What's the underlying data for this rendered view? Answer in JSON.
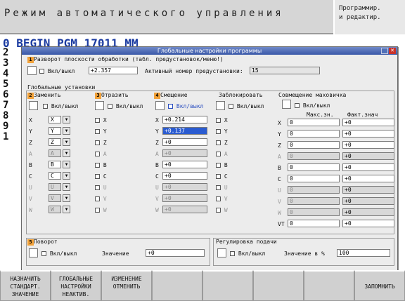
{
  "header": {
    "title": "Режим автоматического управления",
    "mode": "Программир.\nи редактир."
  },
  "program": {
    "first_line": "0 BEGIN PGM 17011 MM",
    "line_numbers": [
      "1",
      "2",
      "3",
      "4",
      "5",
      "6",
      "7",
      "8",
      "9",
      "1"
    ]
  },
  "dialog": {
    "title": "Глобальные настройки программы",
    "plane_tilt": {
      "num": "1",
      "label": "Разворот плоскости обработки (табл. предустановок/меню!)",
      "toggle": "Вкл/выкл",
      "value": "+2.357",
      "preset_label": "Активный номер предустановки:",
      "preset_value": "15"
    },
    "global_section": "Глобальные установки",
    "swap": {
      "num": "2",
      "label": "Заменить",
      "toggle": "Вкл/выкл",
      "axes": [
        "X",
        "Y",
        "Z",
        "A",
        "B",
        "C",
        "U",
        "V",
        "W"
      ],
      "targets": [
        "X",
        "Y",
        "Z",
        "A",
        "B",
        "C",
        "U",
        "V",
        "W"
      ]
    },
    "mirror": {
      "num": "3",
      "label": "Отразить",
      "toggle": "Вкл/выкл",
      "axes": [
        "X",
        "Y",
        "Z",
        "A",
        "B",
        "C",
        "U",
        "V",
        "W"
      ]
    },
    "shift": {
      "num": "4",
      "label": "Смещение",
      "toggle": "Вкл/выкл",
      "axes": [
        "X",
        "Y",
        "Z",
        "A",
        "B",
        "C",
        "U",
        "V",
        "W"
      ],
      "values": [
        "+0.214",
        "+0.137",
        "+0",
        "+0",
        "+0",
        "+0",
        "+0",
        "+0",
        "+0"
      ]
    },
    "lock": {
      "label": "Заблокировать",
      "toggle": "Вкл/выкл",
      "axes": [
        "X",
        "Y",
        "Z",
        "A",
        "B",
        "C",
        "U",
        "V",
        "W"
      ]
    },
    "handwheel": {
      "label": "Совмещение маховичка",
      "toggle": "Вкл/выкл",
      "col_max": "Макс.зн.",
      "col_act": "Факт.знач",
      "axes": [
        "X",
        "Y",
        "Z",
        "A",
        "B",
        "C",
        "U",
        "V",
        "W",
        "VT"
      ],
      "max": [
        "0",
        "0",
        "0",
        "0",
        "0",
        "0",
        "0",
        "0",
        "0",
        "0"
      ],
      "act": [
        "+0",
        "+0",
        "+0",
        "+0",
        "+0",
        "+0",
        "+0",
        "+0",
        "+0",
        "+0"
      ]
    },
    "rotation": {
      "num": "5",
      "label": "Поворот",
      "toggle": "Вкл/выкл",
      "value_label": "Значение",
      "value": "+0"
    },
    "feed": {
      "label": "Регулировка подачи",
      "toggle": "Вкл/выкл",
      "value_label": "Значение в %",
      "value": "100"
    }
  },
  "softkeys": [
    "НАЗНАЧИТЬ\nСТАНДАРТ.\nЗНАЧЕНИЕ",
    "ГЛОБАЛЬНЫЕ\nНАСТРОЙКИ\nНЕАКТИВ.",
    "ИЗМЕНЕНИЕ\nОТМЕНИТЬ",
    "",
    "",
    "",
    "",
    "ЗАПОМНИТЬ"
  ]
}
